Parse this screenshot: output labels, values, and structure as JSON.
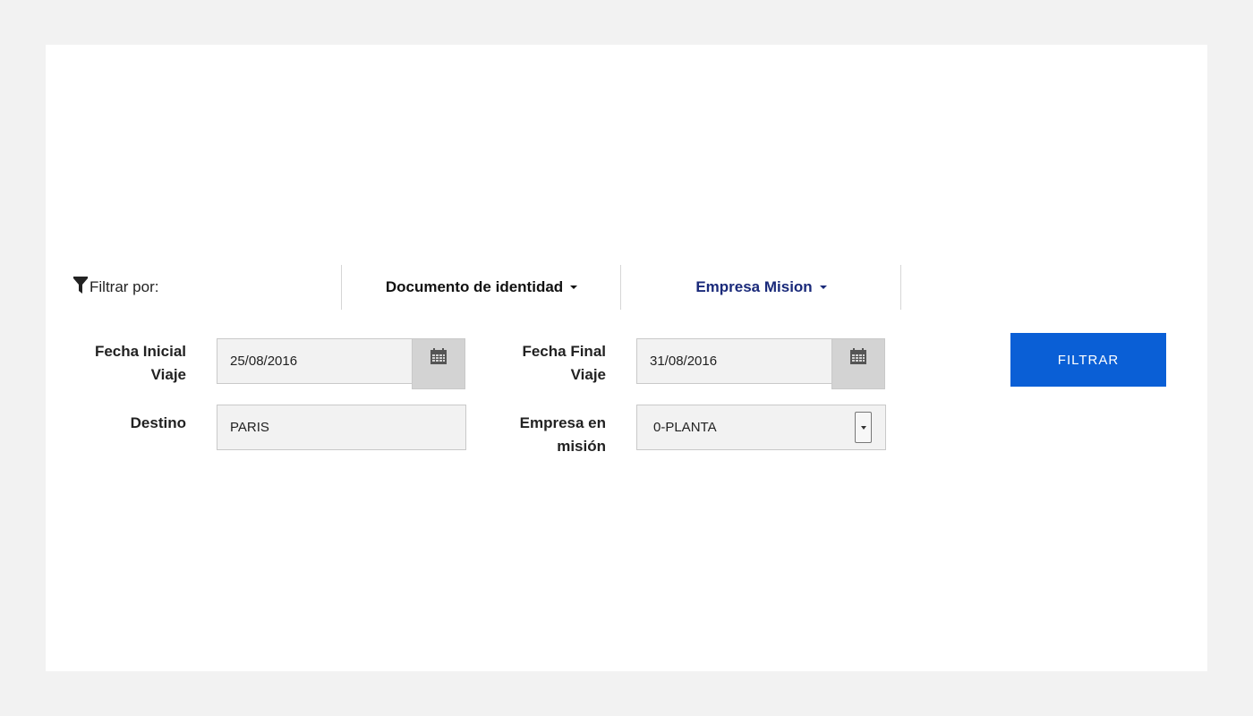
{
  "filter_bar": {
    "label": "Filtrar por:",
    "tabs": [
      {
        "label": "Documento de identidad"
      },
      {
        "label": "Empresa Mision"
      }
    ]
  },
  "form": {
    "fecha_inicial": {
      "label_line1": "Fecha Inicial",
      "label_line2": "Viaje",
      "value": "25/08/2016"
    },
    "fecha_final": {
      "label_line1": "Fecha Final",
      "label_line2": "Viaje",
      "value": "31/08/2016"
    },
    "destino": {
      "label": "Destino",
      "value": "PARIS"
    },
    "empresa": {
      "label_line1": "Empresa en",
      "label_line2": "misión",
      "value": "0-PLANTA"
    },
    "submit_label": "FILTRAR"
  },
  "colors": {
    "accent": "#0a5fd6",
    "active_tab": "#1a2a7a"
  }
}
